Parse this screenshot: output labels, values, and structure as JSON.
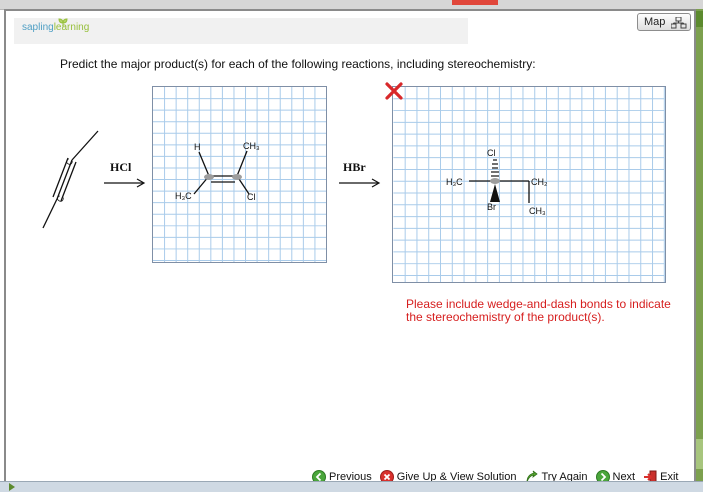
{
  "window": {
    "map_label": "Map"
  },
  "logo": {
    "part1": "sapling",
    "part2": "learning"
  },
  "question": {
    "prompt": "Predict the major product(s) for each of the following reactions, including stereochemistry:"
  },
  "reaction1": {
    "reagent": "HCl",
    "reactant_atoms": [
      "C",
      "C"
    ],
    "product_labels": {
      "h": "H",
      "ch3": "CH₃",
      "h3c": "H₃C",
      "cl": "Cl"
    }
  },
  "reaction2": {
    "reagent": "HBr",
    "answer_labels": {
      "h3c": "H₃C",
      "cl": "Cl",
      "br": "Br",
      "ch2": "CH₂",
      "ch3": "CH₃"
    }
  },
  "feedback": {
    "message": "Please include wedge-and-dash bonds to indicate the stereochemistry of the product(s)."
  },
  "nav": {
    "previous": "Previous",
    "give_up": "Give Up & View Solution",
    "try_again": "Try Again",
    "next": "Next",
    "exit": "Exit"
  },
  "colors": {
    "grid": "#a9cbea",
    "error": "#d61f1f",
    "accent_green": "#7ca04e"
  }
}
